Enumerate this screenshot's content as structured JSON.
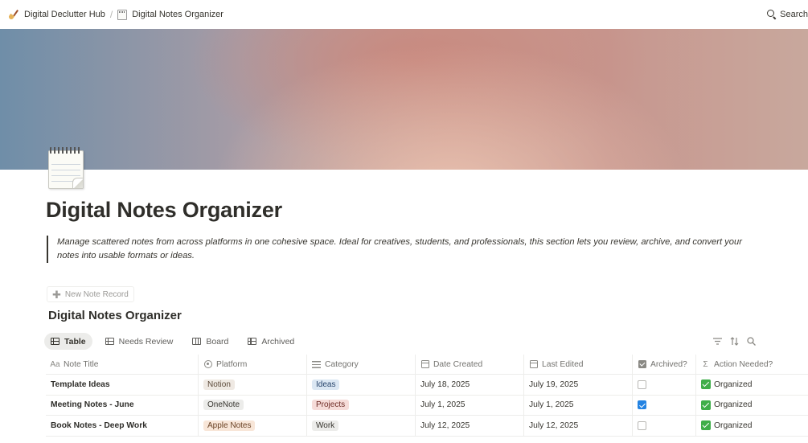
{
  "breadcrumb": {
    "items": [
      {
        "label": "Digital Declutter Hub",
        "icon": "broom-icon"
      },
      {
        "label": "Digital Notes Organizer",
        "icon": "notepad-icon"
      }
    ],
    "separator": "/"
  },
  "topbar": {
    "search_label": "Search"
  },
  "page": {
    "icon": "spiral-notepad-icon",
    "title": "Digital Notes Organizer",
    "quote": "Manage scattered notes from across platforms in one cohesive space. Ideal for creatives, students, and professionals, this section lets you review, archive, and convert your notes into usable formats or ideas."
  },
  "database": {
    "new_button_label": "New Note Record",
    "title": "Digital Notes Organizer",
    "views": [
      {
        "label": "Table",
        "icon": "table-icon",
        "active": true
      },
      {
        "label": "Needs Review",
        "icon": "table-icon",
        "active": false
      },
      {
        "label": "Board",
        "icon": "board-icon",
        "active": false
      },
      {
        "label": "Archived",
        "icon": "table-icon",
        "active": false
      }
    ],
    "tools": [
      "filter-icon",
      "sort-icon",
      "search-icon"
    ],
    "columns": [
      {
        "label": "Note Title",
        "icon": "text-property-icon",
        "glyph": "Aa"
      },
      {
        "label": "Platform",
        "icon": "select-property-icon"
      },
      {
        "label": "Category",
        "icon": "multi-select-property-icon"
      },
      {
        "label": "Date Created",
        "icon": "calendar-icon"
      },
      {
        "label": "Last Edited",
        "icon": "calendar-icon"
      },
      {
        "label": "Archived?",
        "icon": "checkbox-property-icon"
      },
      {
        "label": "Action Needed?",
        "icon": "formula-icon",
        "glyph": "Σ"
      }
    ],
    "rows": [
      {
        "title": "Template Ideas",
        "platform": "Notion",
        "category": "Ideas",
        "created": "July 18, 2025",
        "edited": "July 19, 2025",
        "archived": false,
        "action": "Organized"
      },
      {
        "title": "Meeting Notes - June",
        "platform": "OneNote",
        "category": "Projects",
        "created": "July 1, 2025",
        "edited": "July 1, 2025",
        "archived": true,
        "action": "Organized"
      },
      {
        "title": "Book Notes - Deep Work",
        "platform": "Apple Notes",
        "category": "Work",
        "created": "July 12, 2025",
        "edited": "July 12, 2025",
        "archived": false,
        "action": "Organized"
      }
    ]
  },
  "colors": {
    "tag_notion_bg": "#efe9e3",
    "tag_notion_fg": "#5c4a3a",
    "tag_onenote_bg": "#ececea",
    "tag_onenote_fg": "#37352f",
    "tag_applenotes_bg": "#f8e6d8",
    "tag_applenotes_fg": "#6b4326",
    "tag_ideas_bg": "#dbe7f3",
    "tag_ideas_fg": "#28456c",
    "tag_projects_bg": "#f6dcd9",
    "tag_projects_fg": "#6e2a25",
    "tag_work_bg": "#ececea",
    "tag_work_fg": "#37352f",
    "checkbox_on": "#2383e2",
    "action_check": "#3fae49"
  }
}
